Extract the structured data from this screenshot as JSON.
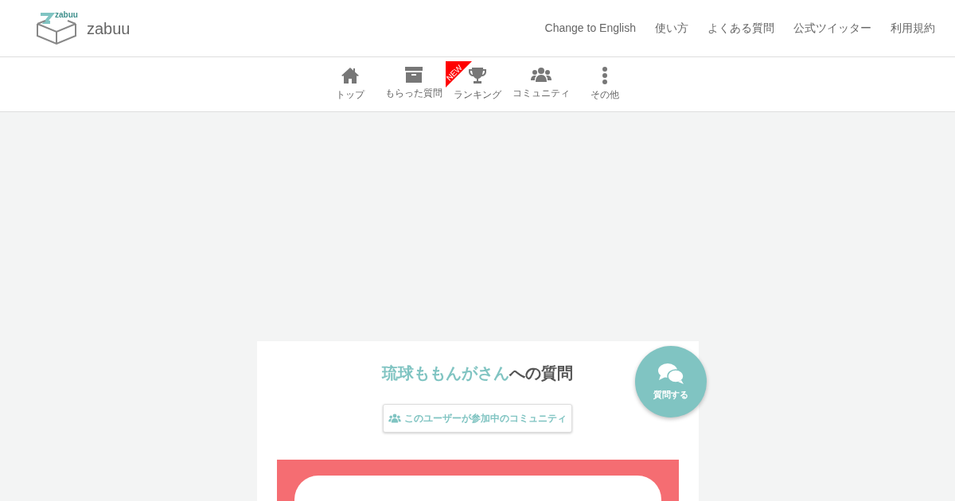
{
  "brand": {
    "name": "zabuu",
    "logo_text": "zabuu"
  },
  "header_links": [
    "Change to English",
    "使い方",
    "よくある質問",
    "公式ツイッター",
    "利用規約"
  ],
  "nav": [
    {
      "label": "トップ",
      "kind": "home"
    },
    {
      "label": "もらった質問",
      "kind": "archive"
    },
    {
      "label": "ランキング",
      "kind": "trophy",
      "badge": "NEW"
    },
    {
      "label": "コミュニティ",
      "kind": "users"
    },
    {
      "label": "その他",
      "kind": "dots"
    }
  ],
  "card": {
    "title_name": "琉球ももんがさん",
    "title_suffix": "への質問",
    "community_button": "このユーザーが参加中のコミュニティ"
  },
  "ask_button": "質問する"
}
